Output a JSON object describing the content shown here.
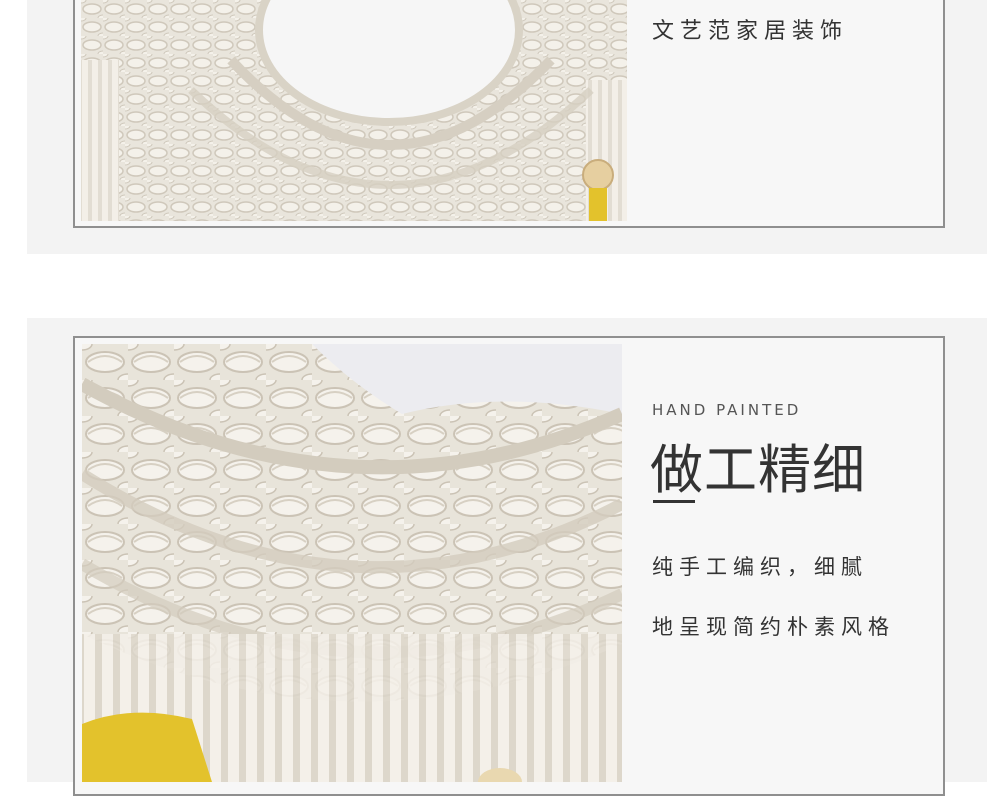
{
  "top_section": {
    "caption": "文艺范家居装饰"
  },
  "bottom_section": {
    "eyebrow": "HAND PAINTED",
    "headline": "做工精细",
    "body_line1": "纯手工编织，细腻",
    "body_line2": "地呈现简约朴素风格"
  },
  "colors": {
    "panel_bg": "#f3f3f3",
    "frame_border": "#8f8f8f",
    "text": "#333333",
    "yarn_cream": "#f1ede4",
    "tassel_yellow": "#e3c22c"
  },
  "images": {
    "top_photo": "macrame-wall-mirror-photo",
    "bottom_photo": "macrame-closeup-photo"
  }
}
